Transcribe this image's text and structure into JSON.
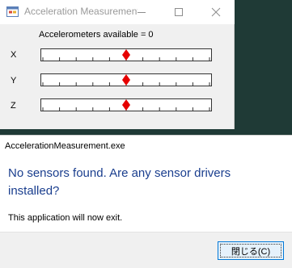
{
  "main_window": {
    "title": "Acceleration Measurement",
    "status_label": "Accelerometers available = 0",
    "axes": [
      {
        "label": "X",
        "value": 0.5
      },
      {
        "label": "Y",
        "value": 0.5
      },
      {
        "label": "Z",
        "value": 0.5
      }
    ],
    "marker_color": "#e60000"
  },
  "message_box": {
    "title": "AccelerationMeasurement.exe",
    "heading": "No sensors found. Are any sensor drivers installed?",
    "body": "This application will now exit.",
    "close_button": "閉じる(C)",
    "heading_color": "#1a3e8e"
  }
}
